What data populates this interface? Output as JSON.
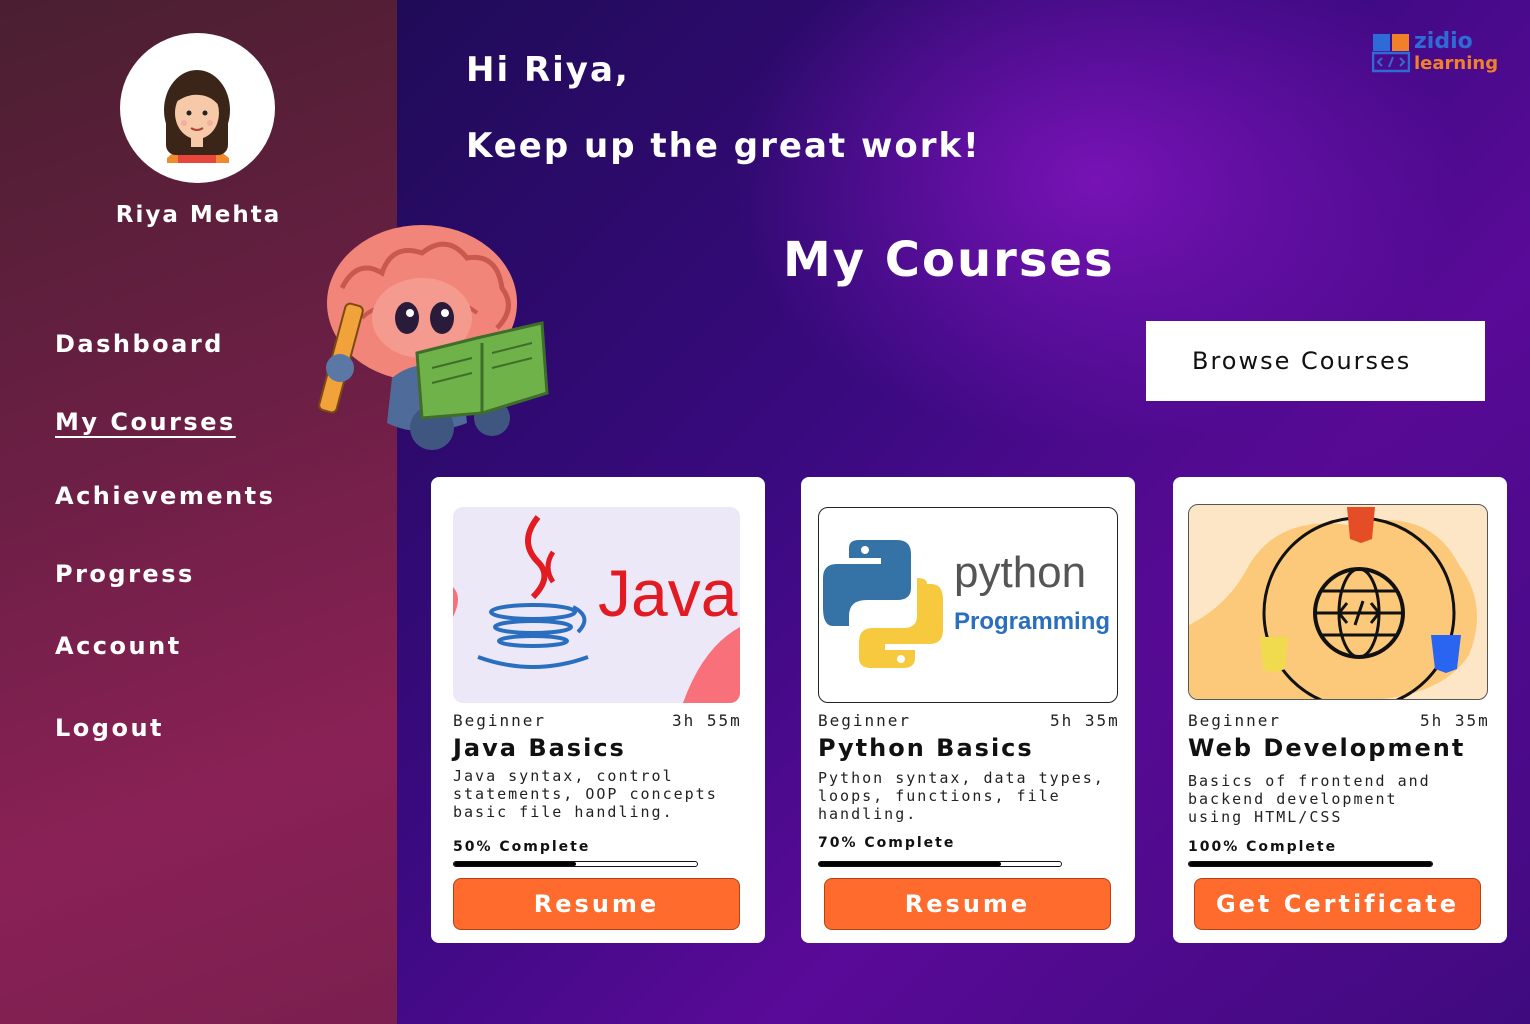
{
  "user": {
    "name": "Riya Mehta"
  },
  "nav": [
    {
      "label": "Dashboard",
      "active": false
    },
    {
      "label": "My Courses",
      "active": true
    },
    {
      "label": "Achievements",
      "active": false
    },
    {
      "label": "Progress",
      "active": false
    },
    {
      "label": "Account",
      "active": false
    },
    {
      "label": "Logout",
      "active": false
    }
  ],
  "greeting": {
    "line1": "Hi Riya,",
    "line2": "Keep up the great work!"
  },
  "logo": {
    "line1": "zidio",
    "line2": "learning"
  },
  "page_title": "My Courses",
  "browse_button": "Browse Courses",
  "courses": [
    {
      "thumb_text": "Java",
      "level": "Beginner",
      "duration": "3h 55m",
      "title": "Java Basics",
      "desc": [
        "Java syntax, control",
        "statements, OOP concepts",
        "basic file handling."
      ],
      "progress_label": "50% Complete",
      "progress": 0.5,
      "button": "Resume"
    },
    {
      "thumb_text": "python",
      "thumb_subtext": "Programming",
      "level": "Beginner",
      "duration": "5h 35m",
      "title": "Python Basics",
      "desc": [
        "Python syntax, data types,",
        "loops, functions, file",
        "handling."
      ],
      "progress_label": "70% Complete",
      "progress": 0.75,
      "button": "Resume"
    },
    {
      "level": "Beginner",
      "duration": "5h 35m",
      "title": "Web Development",
      "desc": [
        "Basics of frontend and",
        "backend development",
        "using HTML/CSS"
      ],
      "progress_label": "100% Complete",
      "progress": 1.0,
      "button": "Get Certificate"
    }
  ],
  "colors": {
    "accent": "#ff6b2c",
    "sidebar": "#7a1f4f",
    "main": "#4a0a8c"
  }
}
